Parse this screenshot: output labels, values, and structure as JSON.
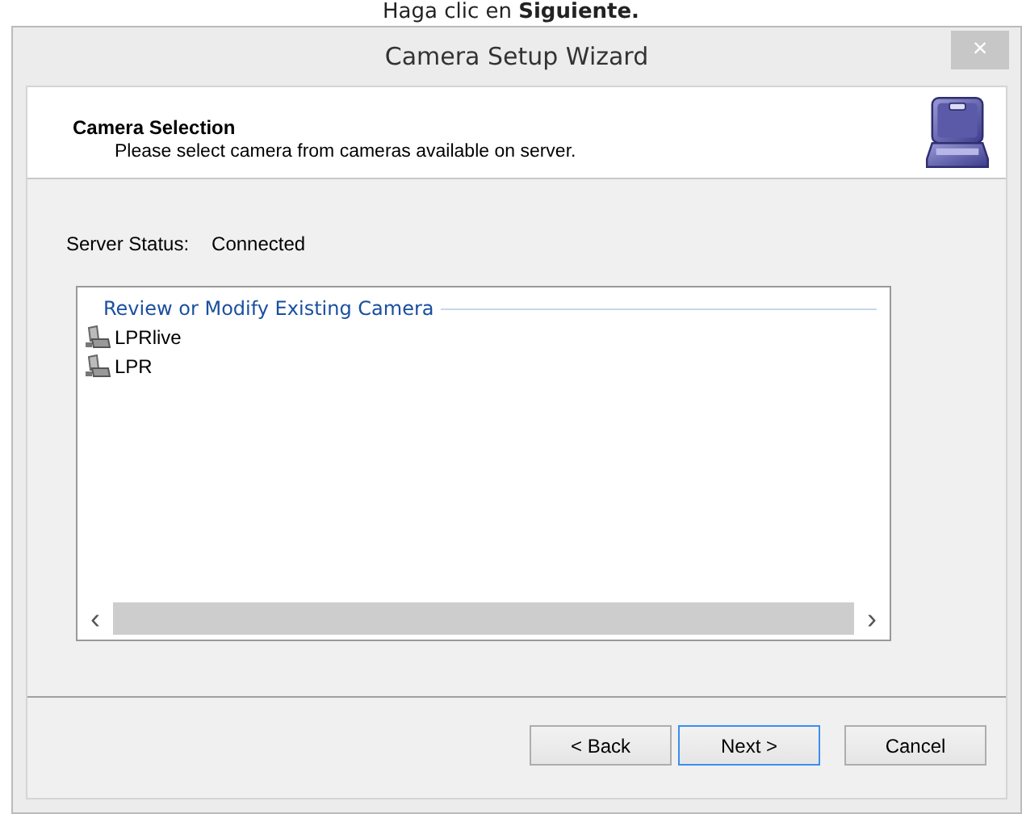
{
  "caption": "Haga clic en **Siguiente.**",
  "window": {
    "title": "Camera Setup Wizard",
    "close": "×"
  },
  "header": {
    "title": "Camera Selection",
    "subtitle": "Please select camera from cameras available on server."
  },
  "server_status": {
    "label": "Server Status:",
    "value": "Connected"
  },
  "camera_list": {
    "group": "Review or Modify Existing Camera",
    "items": [
      {
        "name": "LPRlive"
      },
      {
        "name": "LPR"
      }
    ],
    "scroll_left": "‹",
    "scroll_right": "›"
  },
  "buttons": [
    {
      "label": "< Back",
      "default": false
    },
    {
      "label": "Next >",
      "default": true
    },
    {
      "label": "Cancel",
      "default": false
    }
  ]
}
